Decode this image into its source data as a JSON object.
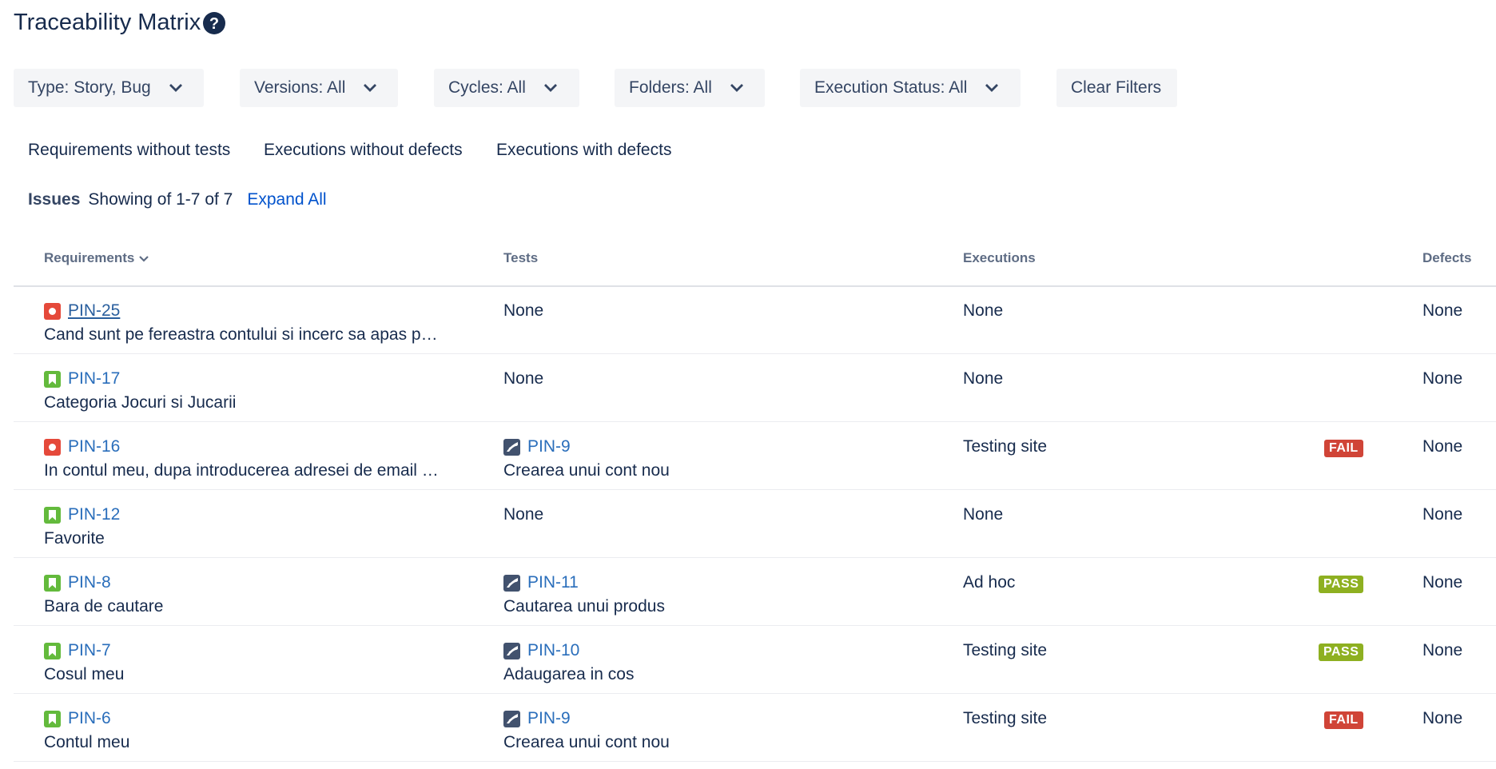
{
  "page": {
    "title": "Traceability Matrix"
  },
  "filters": [
    {
      "label": "Type: Story, Bug"
    },
    {
      "label": "Versions: All"
    },
    {
      "label": "Cycles: All"
    },
    {
      "label": "Folders: All"
    },
    {
      "label": "Execution Status: All"
    }
  ],
  "clear_filters": "Clear Filters",
  "quick_filters": [
    "Requirements without tests",
    "Executions without defects",
    "Executions with defects"
  ],
  "issues": {
    "label": "Issues",
    "showing": "Showing of 1-7 of 7",
    "expand_all": "Expand All"
  },
  "columns": {
    "requirements": "Requirements",
    "tests": "Tests",
    "executions": "Executions",
    "defects": "Defects"
  },
  "rows": [
    {
      "req_key": "PIN-25",
      "req_type": "bug",
      "req_summary": "Cand sunt pe fereastra contului si incerc sa apas p…",
      "test_key": "",
      "test_summary": "None",
      "execution": "None",
      "status": "",
      "defects": "None"
    },
    {
      "req_key": "PIN-17",
      "req_type": "story",
      "req_summary": "Categoria Jocuri si Jucarii",
      "test_key": "",
      "test_summary": "None",
      "execution": "None",
      "status": "",
      "defects": "None"
    },
    {
      "req_key": "PIN-16",
      "req_type": "bug",
      "req_summary": "In contul meu, dupa introducerea adresei de email …",
      "test_key": "PIN-9",
      "test_summary": "Crearea unui cont nou",
      "execution": "Testing site",
      "status": "FAIL",
      "defects": "None"
    },
    {
      "req_key": "PIN-12",
      "req_type": "story",
      "req_summary": "Favorite",
      "test_key": "",
      "test_summary": "None",
      "execution": "None",
      "status": "",
      "defects": "None"
    },
    {
      "req_key": "PIN-8",
      "req_type": "story",
      "req_summary": "Bara de cautare",
      "test_key": "PIN-11",
      "test_summary": "Cautarea unui produs",
      "execution": "Ad hoc",
      "status": "PASS",
      "defects": "None"
    },
    {
      "req_key": "PIN-7",
      "req_type": "story",
      "req_summary": "Cosul meu",
      "test_key": "PIN-10",
      "test_summary": "Adaugarea in cos",
      "execution": "Testing site",
      "status": "PASS",
      "defects": "None"
    },
    {
      "req_key": "PIN-6",
      "req_type": "story",
      "req_summary": "Contul meu",
      "test_key": "PIN-9",
      "test_summary": "Crearea unui cont nou",
      "execution": "Testing site",
      "status": "FAIL",
      "defects": "None"
    }
  ],
  "colors": {
    "link": "#2a6ebb",
    "bug": "#e5493a",
    "story": "#63ba3c",
    "fail": "#d04437",
    "pass": "#8eb021",
    "filter_bg": "#f4f5f7"
  }
}
